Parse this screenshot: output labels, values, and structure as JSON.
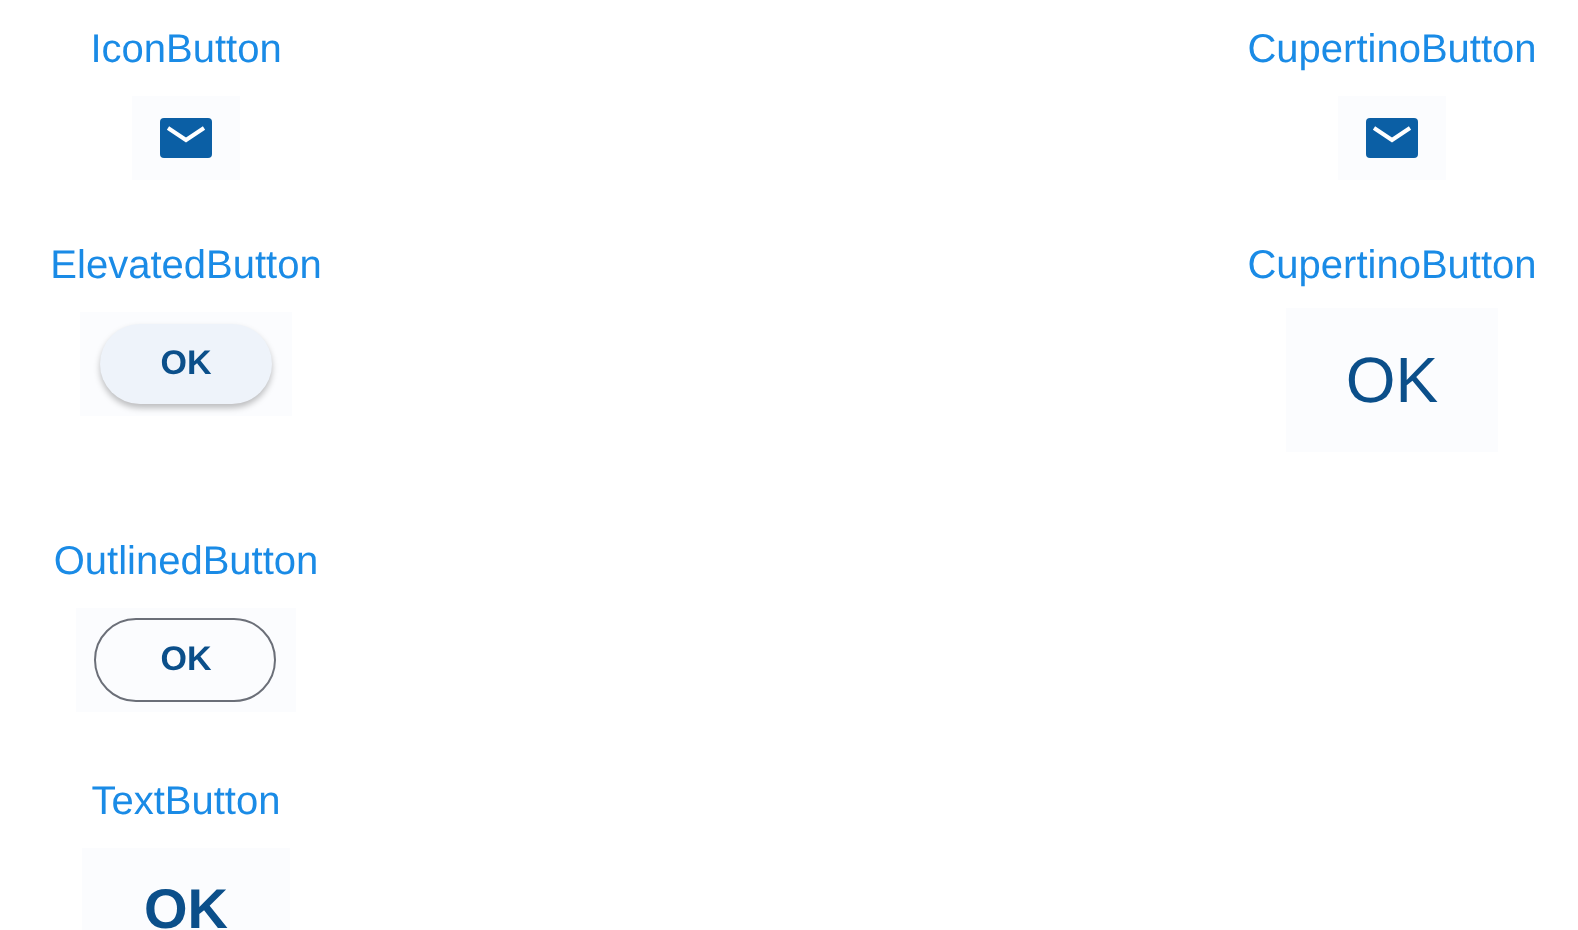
{
  "columns": [
    {
      "items": [
        {
          "kind": "icon",
          "label": "IconButton"
        },
        {
          "kind": "elevated",
          "label": "ElevatedButton",
          "button": "OK"
        },
        {
          "kind": "outlined",
          "label": "OutlinedButton",
          "button": "OK"
        },
        {
          "kind": "text",
          "label": "TextButton",
          "button": "OK"
        }
      ]
    },
    {
      "items": [
        {
          "kind": "icon",
          "label": "CupertinoButton"
        },
        {
          "kind": "cupertino",
          "label": "CupertinoButton",
          "button": "OK"
        }
      ]
    }
  ]
}
